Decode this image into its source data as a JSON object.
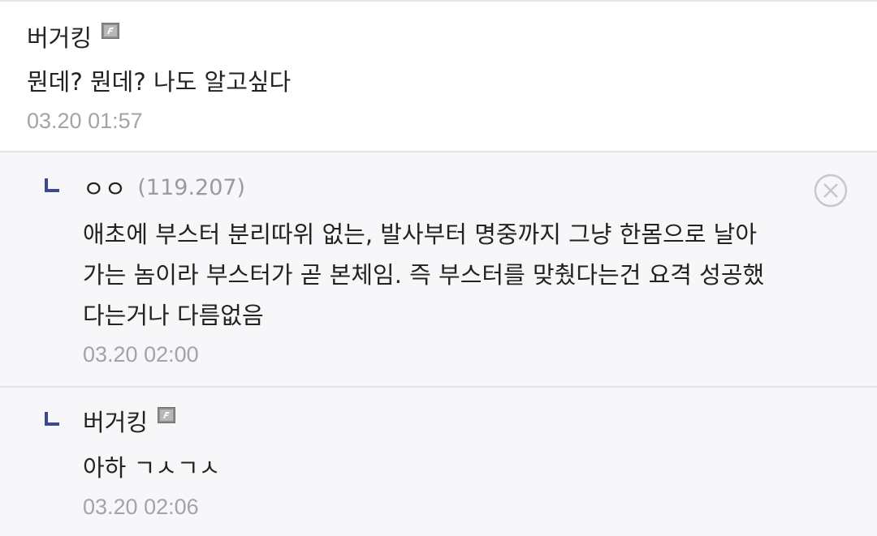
{
  "comments": [
    {
      "nickname": "버거킹",
      "text": "뭔데? 뭔데? 나도 알고싶다",
      "date": "03.20 01:57"
    },
    {
      "nickname": "ㅇㅇ",
      "ip": "(119.207)",
      "lines": [
        "애초에 부스터 분리따위 없는, 발사부터 명중까지 그냥 한몸으로 날아",
        "가는 놈이라 부스터가 곧 본체임. 즉 부스터를 맞췄다는건 요격 성공했",
        "다는거나 다름없음"
      ],
      "date": "03.20 02:00"
    },
    {
      "nickname": "버거킹",
      "text": "아하 ㄱㅅㄱㅅ",
      "date": "03.20 02:06"
    }
  ],
  "colors": {
    "reply_background": "#f7f7f9",
    "divider": "#e4e4ea",
    "reply_mark": "#3b4890",
    "meta_gray": "#a3a3a8"
  },
  "icons": {
    "fixed_nick": "fixed-nickname-icon",
    "reply": "reply-arrow-icon",
    "delete": "close-circle-icon"
  }
}
